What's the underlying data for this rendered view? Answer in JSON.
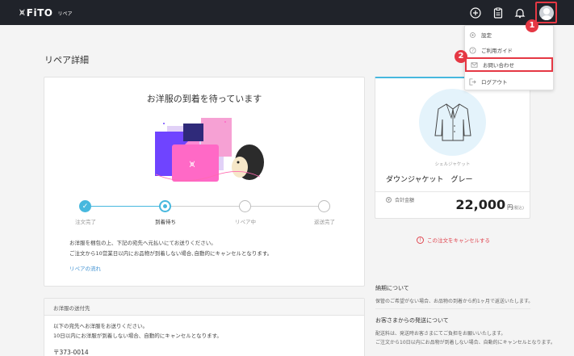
{
  "header": {
    "brand": "FiTO",
    "brand_mark": "⩙",
    "section": "リペア",
    "icons": [
      "plus-circle-icon",
      "clipboard-icon",
      "bell-icon",
      "user-avatar-icon"
    ]
  },
  "page": {
    "title": "リペア詳細"
  },
  "status_card": {
    "title": "お洋服の到着を待っています",
    "steps": [
      {
        "label": "注文完了",
        "state": "done"
      },
      {
        "label": "到着待ち",
        "state": "current"
      },
      {
        "label": "リペア中",
        "state": "pending"
      },
      {
        "label": "返送完了",
        "state": "pending"
      }
    ],
    "line1": "お洋服を梱包の上、下記の宛先へ元払いにてお送りください。",
    "line2": "ご注文から10営業日以内にお品物が到着しない場合､自動的にキャンセルとなります。",
    "link": "リペアの流れ",
    "step_check": "✓"
  },
  "address_card": {
    "heading": "お洋服の送付先",
    "line1": "以下の宛先へお洋服をお送りください。",
    "line2": "10日以内にお洋服が到着しない場合、自動的にキャンセルとなります。",
    "postal": "〒373-0014"
  },
  "product_card": {
    "category": "シェルジャケット",
    "name": "ダウンジャケット　グレー",
    "total_label": "合計金額",
    "price": "22,000",
    "price_unit": "円",
    "tax_note": "(税込)",
    "cancel_link": "この注文をキャンセルする",
    "cancel_icon": "!"
  },
  "side_info": {
    "h1": "納期について",
    "t1": "保管のご希望がない場合、お品物の到着から約1ヶ月で返送いたします。",
    "h2": "お客さまからの発送について",
    "t2a": "配送料は、発送時お客さまにてご負担をお願いいたします。",
    "t2b": "ご注文から10日以内にお品物が到着しない場合、自動的にキャンセルとなります。"
  },
  "dropdown": {
    "items": [
      {
        "label": "設定",
        "icon": "gear-icon"
      },
      {
        "label": "ご利用ガイド",
        "icon": "help-icon"
      },
      {
        "label": "お問い合わせ",
        "icon": "mail-icon"
      },
      {
        "label": "ログアウト",
        "icon": "logout-icon"
      }
    ]
  },
  "annotations": {
    "badge1": "1",
    "badge2": "2"
  },
  "colors": {
    "accent": "#47b8de",
    "highlight": "#e53844",
    "header_bg": "#20232a",
    "link": "#3c8fd1"
  }
}
